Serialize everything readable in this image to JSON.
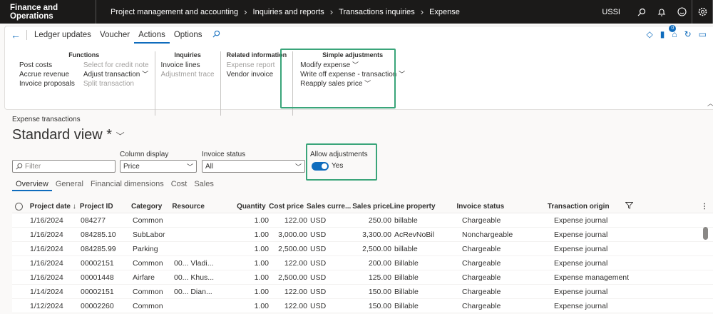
{
  "topbar": {
    "app_name": "Finance and Operations",
    "crumbs": [
      "Project management and accounting",
      "Inquiries and reports",
      "Transactions inquiries",
      "Expense"
    ],
    "company": "USSI"
  },
  "ribbon": {
    "tabs": [
      "Ledger updates",
      "Voucher",
      "Actions",
      "Options"
    ],
    "active_tab": "Actions",
    "groups": {
      "functions": {
        "title": "Functions",
        "col1": [
          "Post costs",
          "Accrue revenue",
          "Invoice proposals"
        ],
        "col2": [
          "Select for credit note",
          "Adjust transaction",
          "Split transaction"
        ]
      },
      "inquiries": {
        "title": "Inquiries",
        "items": [
          "Invoice lines",
          "Adjustment trace"
        ]
      },
      "related": {
        "title": "Related information",
        "items": [
          "Expense report",
          "Vendor invoice"
        ]
      },
      "simple": {
        "title": "Simple adjustments",
        "items": [
          "Modify expense",
          "Write off expense - transaction",
          "Reapply sales price"
        ]
      }
    },
    "notif_count": "0"
  },
  "page": {
    "section": "Expense transactions",
    "view": "Standard view *"
  },
  "filters": {
    "filter_placeholder": "Filter",
    "column_display_label": "Column display",
    "column_display_value": "Price",
    "invoice_status_label": "Invoice status",
    "invoice_status_value": "All",
    "allow_adj_label": "Allow adjustments",
    "allow_adj_value": "Yes"
  },
  "subtabs": [
    "Overview",
    "General",
    "Financial dimensions",
    "Cost",
    "Sales"
  ],
  "grid": {
    "headers": [
      "Project date",
      "Project ID",
      "Category",
      "Resource",
      "Quantity",
      "Cost price",
      "Sales curre...",
      "Sales price",
      "Line property",
      "Invoice status",
      "Transaction origin"
    ],
    "rows": [
      [
        "1/16/2024",
        "084277",
        "Common",
        "",
        "1.00",
        "122.00",
        "USD",
        "250.00",
        "billable",
        "Chargeable",
        "Expense journal"
      ],
      [
        "1/16/2024",
        "084285.10",
        "SubLabor",
        "",
        "1.00",
        "3,000.00",
        "USD",
        "3,300.00",
        "AcRevNoBil",
        "Nonchargeable",
        "Expense journal"
      ],
      [
        "1/16/2024",
        "084285.99",
        "Parking",
        "",
        "1.00",
        "2,500.00",
        "USD",
        "2,500.00",
        "billable",
        "Chargeable",
        "Expense journal"
      ],
      [
        "1/16/2024",
        "00002151",
        "Common",
        "00... Vladi...",
        "1.00",
        "122.00",
        "USD",
        "200.00",
        "Billable",
        "Chargeable",
        "Expense journal"
      ],
      [
        "1/16/2024",
        "00001448",
        "Airfare",
        "00... Khus...",
        "1.00",
        "2,500.00",
        "USD",
        "125.00",
        "Billable",
        "Chargeable",
        "Expense management"
      ],
      [
        "1/14/2024",
        "00002151",
        "Common",
        "00... Dian...",
        "1.00",
        "122.00",
        "USD",
        "150.00",
        "Billable",
        "Chargeable",
        "Expense journal"
      ],
      [
        "1/12/2024",
        "00002260",
        "Common",
        "",
        "1.00",
        "122.00",
        "USD",
        "150.00",
        "Billable",
        "Chargeable",
        "Expense journal"
      ]
    ]
  }
}
